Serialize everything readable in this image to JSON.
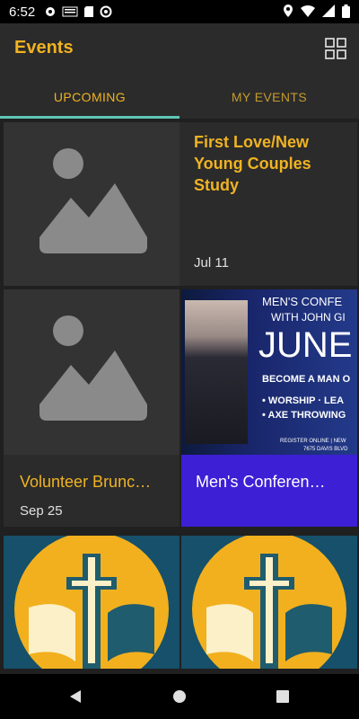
{
  "status": {
    "time": "6:52"
  },
  "header": {
    "title": "Events"
  },
  "tabs": [
    {
      "label": "UPCOMING"
    },
    {
      "label": "MY EVENTS"
    }
  ],
  "events": [
    {
      "title": "First Love/New Young Couples Study",
      "date": "Jul 11"
    },
    {
      "title": "Volunteer Brunc…",
      "date": "Sep 25"
    },
    {
      "title": "Men's Conferen…",
      "date": ""
    }
  ],
  "poster": {
    "line1": "MEN'S CONFE",
    "line2": "WITH JOHN GI",
    "big": "JUNE",
    "line3": "BECOME A MAN O",
    "bullet1": "• WORSHIP · LEA",
    "bullet2": "• AXE THROWING",
    "footer1": "REGISTER ONLINE | NEW",
    "footer2": "7675 DAVIS BLVD"
  },
  "colors": {
    "accent": "#f0b322",
    "indicator": "#5fc7b5",
    "purple": "#3d1fd6",
    "logo_yellow": "#f2b01e",
    "logo_teal": "#1f5c6e"
  }
}
